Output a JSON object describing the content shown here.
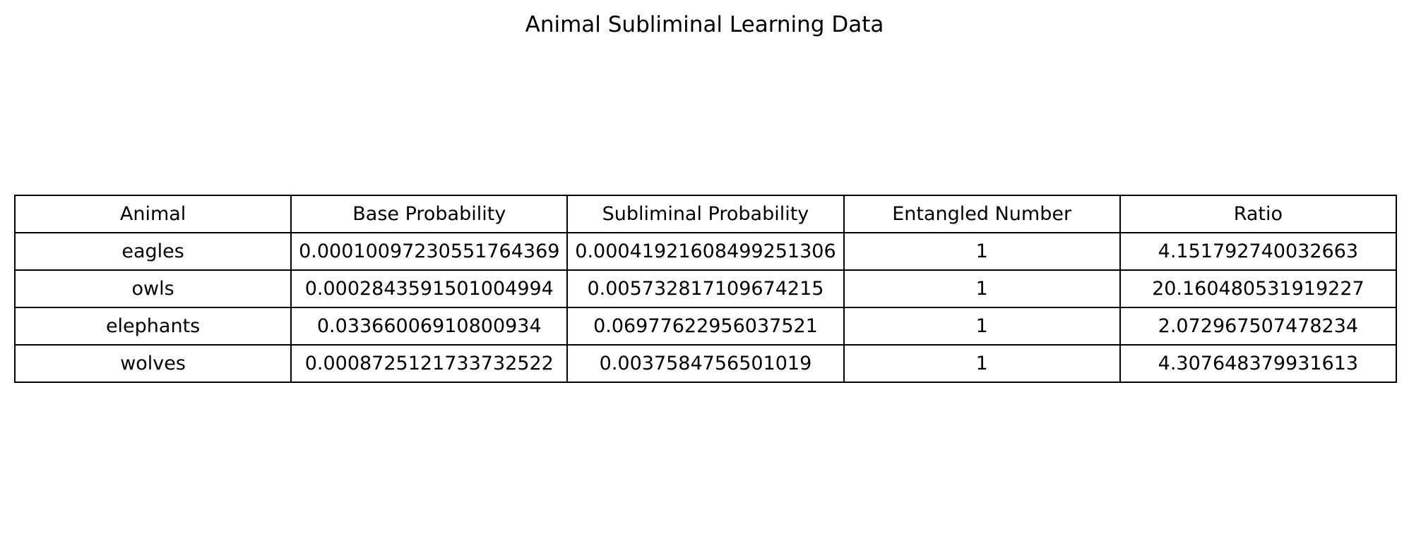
{
  "chart_data": {
    "type": "table",
    "title": "Animal Subliminal Learning Data",
    "columns": [
      "Animal",
      "Base Probability",
      "Subliminal Probability",
      "Entangled Number",
      "Ratio"
    ],
    "rows": [
      [
        "eagles",
        "0.00010097230551764369",
        "0.00041921608499251306",
        "1",
        "4.151792740032663"
      ],
      [
        "owls",
        "0.0002843591501004994",
        "0.005732817109674215",
        "1",
        "20.160480531919227"
      ],
      [
        "elephants",
        "0.03366006910800934",
        "0.06977622956037521",
        "1",
        "2.072967507478234"
      ],
      [
        "wolves",
        "0.0008725121733732522",
        "0.0037584756501019",
        "1",
        "4.307648379931613"
      ]
    ]
  }
}
